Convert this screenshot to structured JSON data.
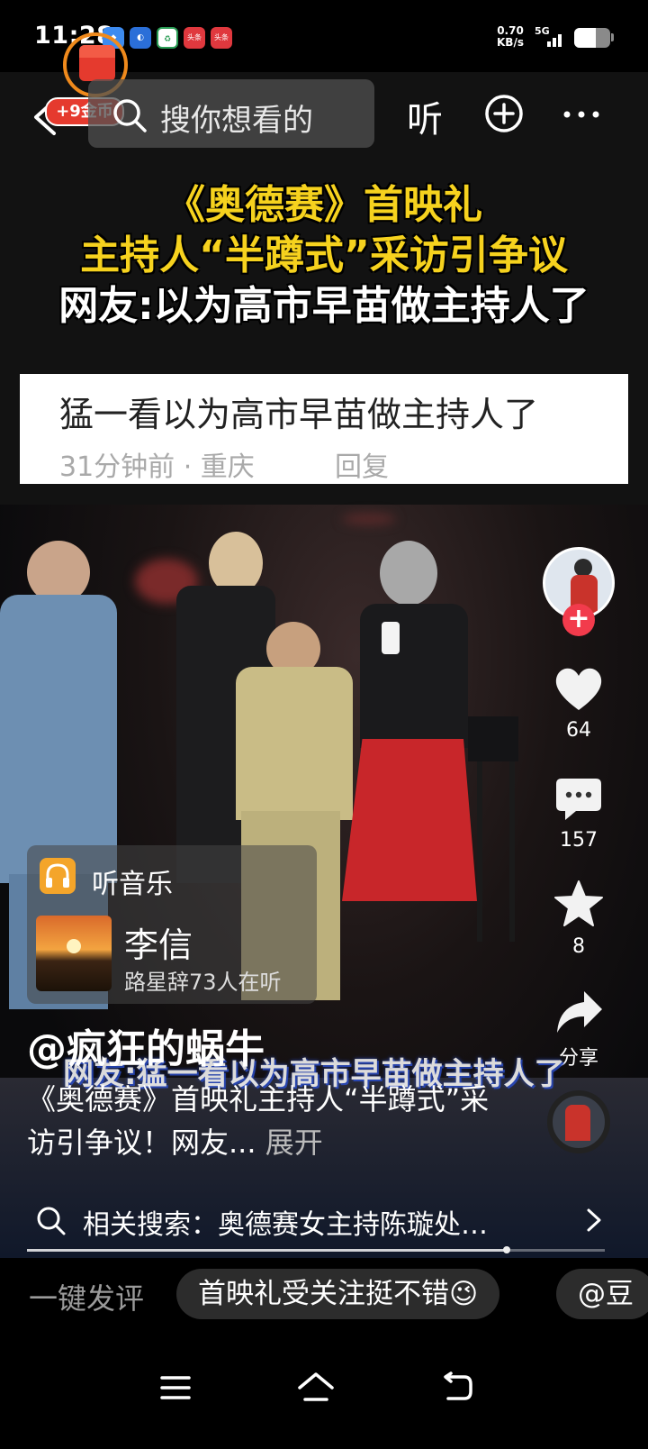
{
  "status_bar": {
    "time": "11:28",
    "notifications": [
      {
        "icon": "app-notification-icon",
        "text": ""
      },
      {
        "icon": "app-notification-icon",
        "text": ""
      },
      {
        "icon": "app-notification-icon",
        "text": ""
      },
      {
        "icon": "toutiao-icon",
        "text": "头条"
      },
      {
        "icon": "toutiao-icon",
        "text": "头条"
      }
    ],
    "net_speed_value": "0.70",
    "net_speed_unit": "KB/s",
    "network": "5G",
    "battery_level": 0.6
  },
  "top_bar": {
    "coins_badge": "+9金币",
    "search_placeholder": "搜你想看的",
    "listen_label": "听"
  },
  "video": {
    "headline_line1": "《奥德赛》首映礼",
    "headline_line2": "主持人“半蹲式”采访引争议",
    "headline_line3": "网友:以为高市早苗做主持人了",
    "comment_text": "猛一看以为高市早苗做主持人了",
    "comment_meta": "31分钟前 · 重庆",
    "comment_reply": "回复",
    "burned_subtitle": "网友:猛一看以为高市早苗做主持人了"
  },
  "right_rail": {
    "likes": "64",
    "comments": "157",
    "favorites": "8",
    "share_label": "分享"
  },
  "music": {
    "label": "听音乐",
    "artist": "李信",
    "listeners": "路星辞73人在听"
  },
  "caption": {
    "author": "@疯狂的蜗牛",
    "description": "《奥德赛》首映礼主持人“半蹲式”采访引争议！网友...",
    "expand": "展开"
  },
  "related_search": {
    "text": "相关搜索：奥德赛女主持陈璇处…"
  },
  "playback": {
    "progress": 0.83
  },
  "comment_bar": {
    "label": "一键发评",
    "chips": [
      "首映礼受关注挺不错😉",
      "@豆"
    ]
  },
  "colors": {
    "accent_red": "#f23b4c",
    "headline_yellow": "#f6d21e",
    "coin_orange": "#f08a1c"
  }
}
